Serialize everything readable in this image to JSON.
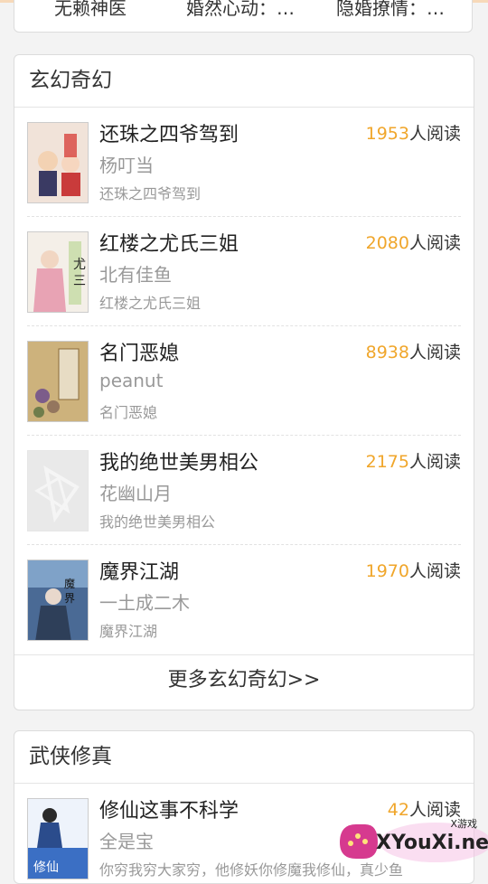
{
  "top_card": {
    "items": [
      "无赖神医",
      "婚然心动：…",
      "隐婚撩情：…"
    ]
  },
  "section1": {
    "title": "玄幻奇幻",
    "books": [
      {
        "title": "还珠之四爷驾到",
        "reads_count": "1953",
        "reads_suffix": "人阅读",
        "author": "杨叮当",
        "desc": "还珠之四爷驾到"
      },
      {
        "title": "红楼之尤氏三姐",
        "reads_count": "2080",
        "reads_suffix": "人阅读",
        "author": "北有佳鱼",
        "desc": "红楼之尤氏三姐"
      },
      {
        "title": "名门恶媳",
        "reads_count": "8938",
        "reads_suffix": "人阅读",
        "author": "peanut",
        "desc": "名门恶媳"
      },
      {
        "title": "我的绝世美男相公",
        "reads_count": "2175",
        "reads_suffix": "人阅读",
        "author": "花幽山月",
        "desc": "我的绝世美男相公"
      },
      {
        "title": "魔界江湖",
        "reads_count": "1970",
        "reads_suffix": "人阅读",
        "author": "一土成二木",
        "desc": "魔界江湖"
      }
    ],
    "more_label": "更多玄幻奇幻>>"
  },
  "section2": {
    "title": "武侠修真",
    "books": [
      {
        "title": "修仙这事不科学",
        "reads_count": "42",
        "reads_suffix": "人阅读",
        "author": "全是宝",
        "desc": "你穷我穷大家穷，他修妖你修魔我修仙，真少鱼"
      }
    ]
  },
  "watermark": {
    "brand": "XYouXi.net",
    "small_text": "X游戏"
  },
  "colors": {
    "accent_count": "#f0a62b",
    "background": "#f3f3f3",
    "card": "#ffffff"
  }
}
